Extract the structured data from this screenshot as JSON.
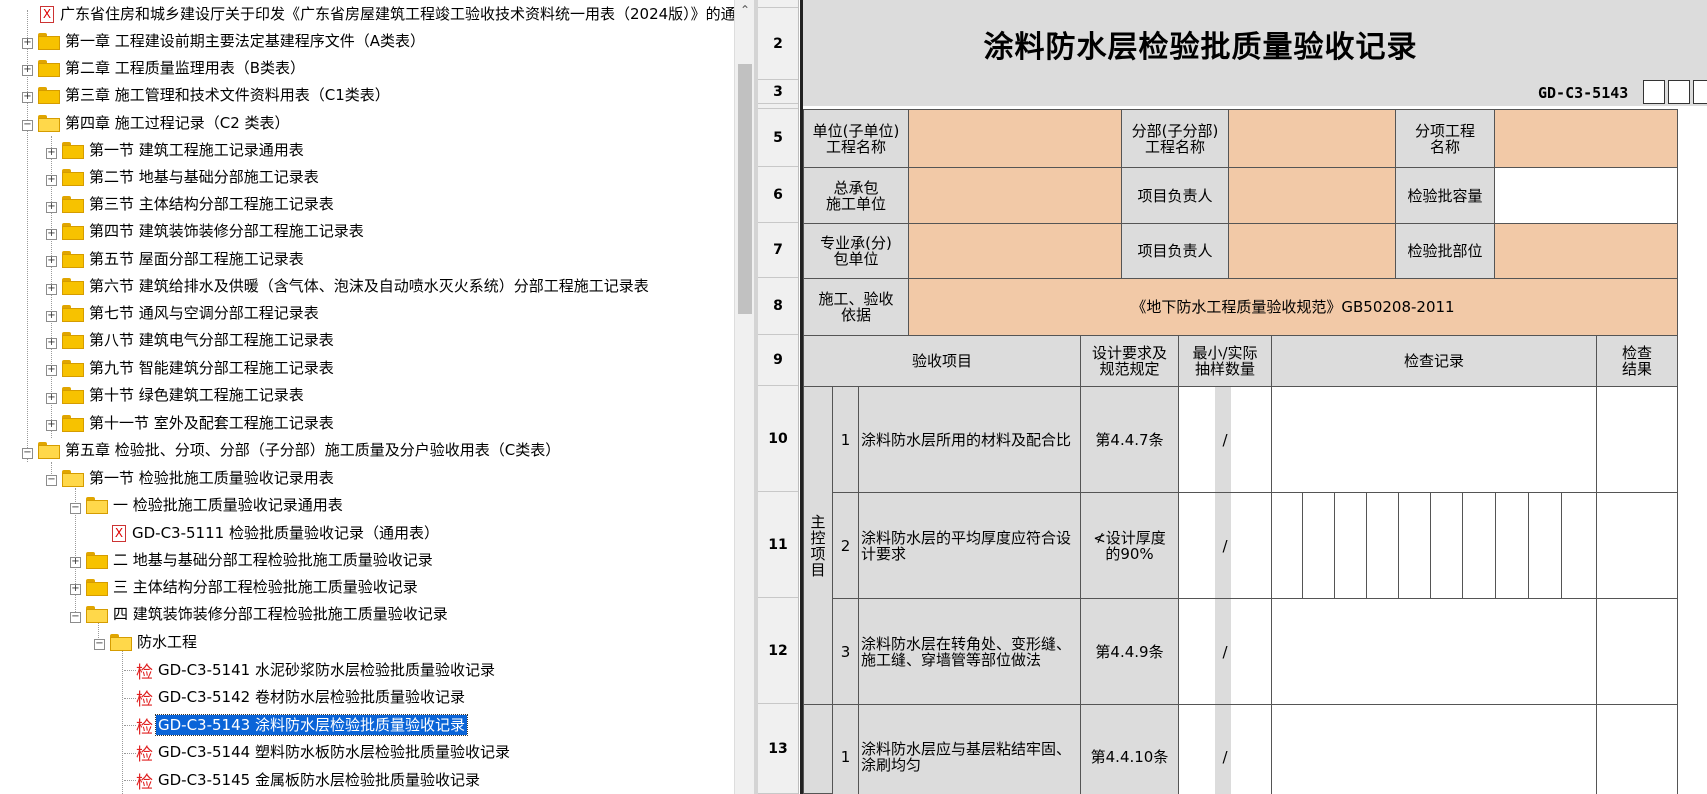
{
  "tree": {
    "top_doc": "广东省住房和城乡建设厅关于印发《广东省房屋建筑工程竣工验收技术资料统一用表（2024版）》的通",
    "chapters": {
      "ch1": "第一章 工程建设前期主要法定基建程序文件（A类表）",
      "ch2": "第二章 工程质量监理用表（B类表）",
      "ch3": "第三章 施工管理和技术文件资料用表（C1类表）",
      "ch4": "第四章 施工过程记录（C2 类表）",
      "ch5": "第五章 检验批、分项、分部（子分部）施工质量及分户验收用表（C类表）"
    },
    "ch4_sections": [
      "第一节 建筑工程施工记录通用表",
      "第二节 地基与基础分部施工记录表",
      "第三节 主体结构分部工程施工记录表",
      "第四节 建筑装饰装修分部工程施工记录表",
      "第五节 屋面分部工程施工记录表",
      "第六节 建筑给排水及供暖（含气体、泡沫及自动喷水灭火系统）分部工程施工记录表",
      "第七节 通风与空调分部工程记录表",
      "第八节 建筑电气分部工程施工记录表",
      "第九节 智能建筑分部工程施工记录表",
      "第十节 绿色建筑工程施工记录表",
      "第十一节 室外及配套工程施工记录表"
    ],
    "ch5_sec1": "第一节 检验批施工质量验收记录用表",
    "groups": {
      "g1": "一 检验批施工质量验收记录通用表",
      "g1_item": "GD-C3-5111 检验批质量验收记录（通用表）",
      "g2": "二 地基与基础分部工程检验批施工质量验收记录",
      "g3": "三 主体结构分部工程检验批施工质量验收记录",
      "g4": "四 建筑装饰装修分部工程检验批施工质量验收记录",
      "waterproof": "防水工程"
    },
    "waterproof_items": [
      "GD-C3-5141 水泥砂浆防水层检验批质量验收记录",
      "GD-C3-5142 卷材防水层检验批质量验收记录",
      "GD-C3-5143 涂料防水层检验批质量验收记录",
      "GD-C3-5144 塑料防水板防水层检验批质量验收记录",
      "GD-C3-5145 金属板防水层检验批质量验收记录"
    ],
    "item_icon_text": "检",
    "doc_icon_text": "X",
    "selected_index": 2
  },
  "scrollbar": {
    "up_arrow": "⌃"
  },
  "sheet": {
    "row_numbers": [
      "2",
      "3",
      "5",
      "6",
      "7",
      "8",
      "9",
      "10",
      "11",
      "12",
      "13"
    ],
    "title": "涂料防水层检验批质量验收记录",
    "form_code": "GD-C3-5143",
    "labels": {
      "unit_name": "单位(子单位)\n工程名称",
      "sub_dept_name": "分部(子分部)\n工程名称",
      "sub_item_name": "分项工程\n名称",
      "general_contractor": "总承包\n施工单位",
      "project_manager_1": "项目负责人",
      "batch_capacity": "检验批容量",
      "sub_contractor": "专业承(分)\n包单位",
      "project_manager_2": "项目负责人",
      "batch_location": "检验批部位",
      "basis_label": "施工、验收\n依据",
      "basis_value": "《地下防水工程质量验收规范》GB50208-2011",
      "col_item": "验收项目",
      "col_design": "设计要求及\n规范规定",
      "col_sample": "最小/实际\n抽样数量",
      "col_record": "检查记录",
      "col_result": "检查\n结果",
      "main_control": "主\n控\n项\n目"
    },
    "items": [
      {
        "no": "1",
        "text": "涂料防水层所用的材料及配合比",
        "spec": "第4.4.7条",
        "sample": "/"
      },
      {
        "no": "2",
        "text": "涂料防水层的平均厚度应符合设计要求",
        "spec": "≮设计厚度\n的90%",
        "sample": "/"
      },
      {
        "no": "3",
        "text": "涂料防水层在转角处、变形缝、施工缝、穿墙管等部位做法",
        "spec": "第4.4.9条",
        "sample": "/"
      },
      {
        "no": "1",
        "text": "涂料防水层应与基层粘结牢固、涂刷均匀",
        "spec": "第4.4.10条",
        "sample": "/"
      }
    ]
  }
}
